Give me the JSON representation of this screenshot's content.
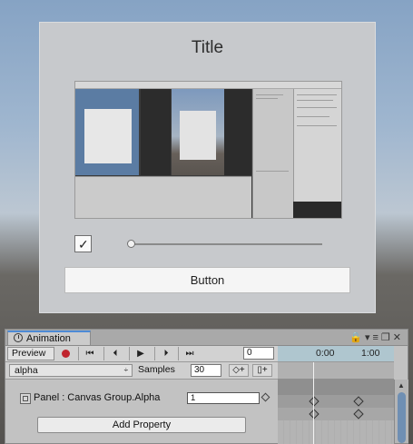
{
  "scene": {
    "panel_title": "Title",
    "toggle_check": "✓",
    "slider_value": 0.0,
    "button_label": "Button"
  },
  "animation_window": {
    "tab_label": "Animation",
    "window_icons": "🔒▾≡❐✕",
    "preview_label": "Preview",
    "transport": [
      "⏮",
      "⏴",
      "▶",
      "⏵",
      "⏭"
    ],
    "frame_value": "0",
    "clip_name": "alpha",
    "clip_arrow": "÷",
    "samples_label": "Samples",
    "samples_value": "30",
    "add_keyframe_icon": "◇+",
    "add_event_icon": "▯+",
    "property_label": "Panel : Canvas Group.Alpha",
    "property_value": "1",
    "add_property_label": "Add Property",
    "timeline_labels": [
      "0:00",
      "1:00"
    ],
    "scroll_up": "▲",
    "accent_color": "#4d8ad6",
    "record_color": "#c0242e"
  }
}
